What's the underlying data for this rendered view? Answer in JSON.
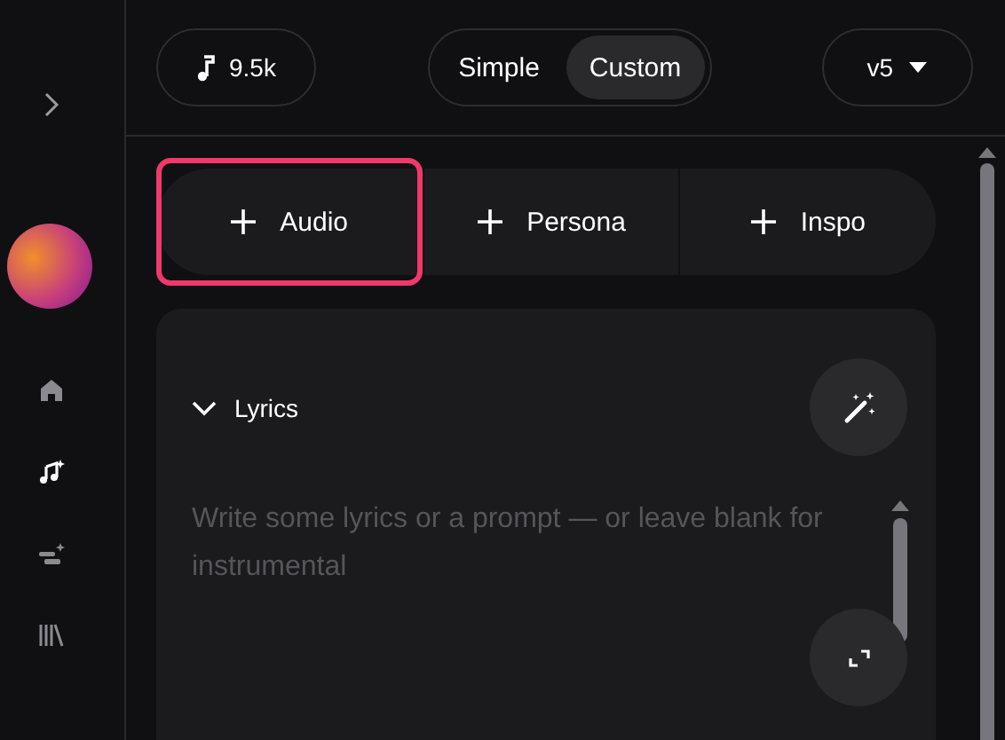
{
  "sidebar": {
    "items": [
      {
        "kind": "home",
        "selected": false
      },
      {
        "kind": "create",
        "selected": true
      },
      {
        "kind": "studio",
        "selected": false
      },
      {
        "kind": "library",
        "selected": false
      }
    ]
  },
  "top_bar": {
    "credits": "9.5k",
    "modes": [
      {
        "label": "Simple",
        "selected": false
      },
      {
        "label": "Custom",
        "selected": true
      }
    ],
    "version": "v5"
  },
  "attachments": [
    {
      "label": "Audio",
      "highlighted": true
    },
    {
      "label": "Persona",
      "highlighted": false
    },
    {
      "label": "Inspo",
      "highlighted": false
    }
  ],
  "lyrics": {
    "title": "Lyrics",
    "expanded": true,
    "placeholder": "Write some lyrics or a prompt — or leave blank for instrumental"
  }
}
